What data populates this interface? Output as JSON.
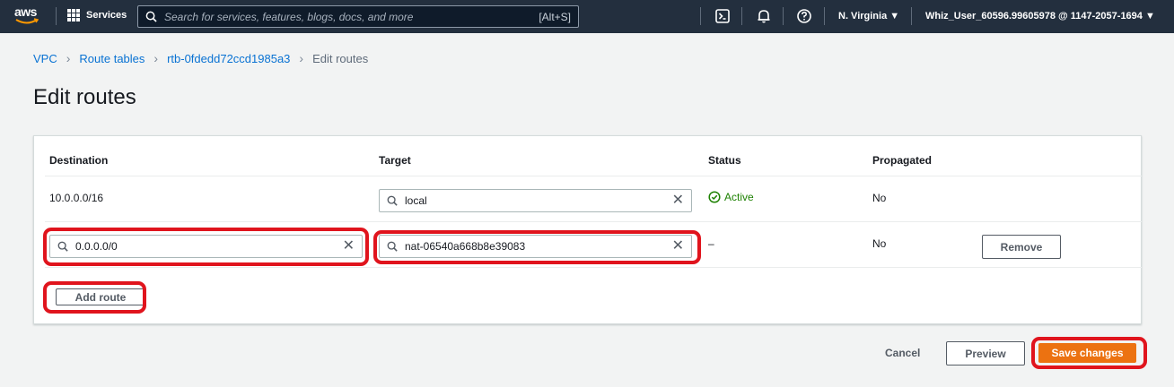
{
  "topnav": {
    "logo_text": "aws",
    "services_label": "Services",
    "search_placeholder": "Search for services, features, blogs, docs, and more",
    "search_shortcut": "[Alt+S]",
    "region": "N. Virginia ▼",
    "account": "Whiz_User_60596.99605978 @ 1147-2057-1694 ▼"
  },
  "breadcrumb": {
    "items": [
      "VPC",
      "Route tables",
      "rtb-0fdedd72ccd1985a3"
    ],
    "current": "Edit routes"
  },
  "page_title": "Edit routes",
  "table": {
    "headers": {
      "destination": "Destination",
      "target": "Target",
      "status": "Status",
      "propagated": "Propagated"
    },
    "rows": [
      {
        "destination": "10.0.0.0/16",
        "target": "local",
        "status": "Active",
        "propagated": "No"
      },
      {
        "destination": "0.0.0.0/0",
        "target": "nat-06540a668b8e39083",
        "status": "–",
        "propagated": "No",
        "action": "Remove"
      }
    ],
    "add_route_label": "Add route"
  },
  "footer": {
    "cancel_label": "Cancel",
    "preview_label": "Preview",
    "save_label": "Save changes"
  },
  "colors": {
    "nav_bg": "#232f3e",
    "link": "#0972d3",
    "active_status": "#1d8102",
    "primary_button": "#ec7211",
    "highlight": "#e0141d"
  }
}
